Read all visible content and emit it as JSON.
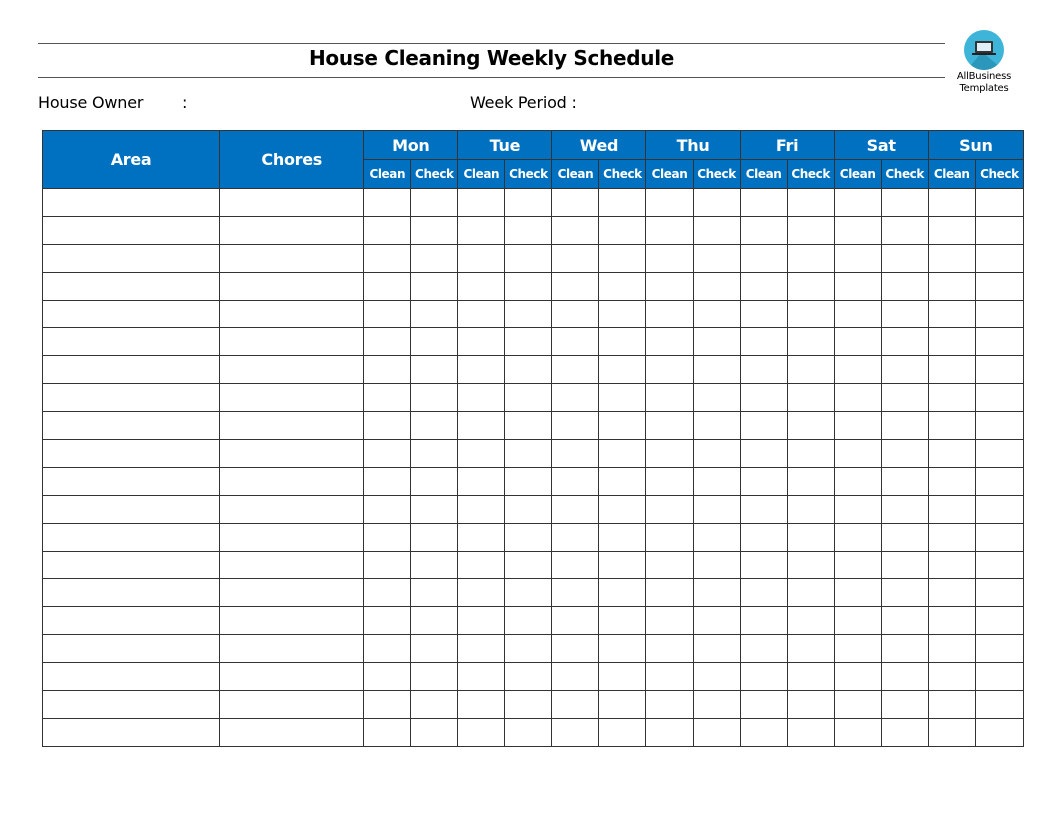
{
  "document": {
    "title": "House Cleaning Weekly Schedule",
    "house_owner_label": "House Owner",
    "house_owner_colon": ":",
    "house_owner_value": "",
    "week_period_label": "Week  Period :",
    "week_period_value": ""
  },
  "logo": {
    "icon": "laptop-icon",
    "line1": "AllBusiness",
    "line2": "Templates",
    "circle_color": "#3db4d8"
  },
  "colors": {
    "header_bg": "#0070c0",
    "header_text": "#ffffff",
    "grid_line": "#333333"
  },
  "table": {
    "col_area": "Area",
    "col_chores": "Chores",
    "days": [
      "Mon",
      "Tue",
      "Wed",
      "Thu",
      "Fri",
      "Sat",
      "Sun"
    ],
    "sub_clean": "Clean",
    "sub_check": "Check",
    "row_count": 20,
    "rows": []
  }
}
